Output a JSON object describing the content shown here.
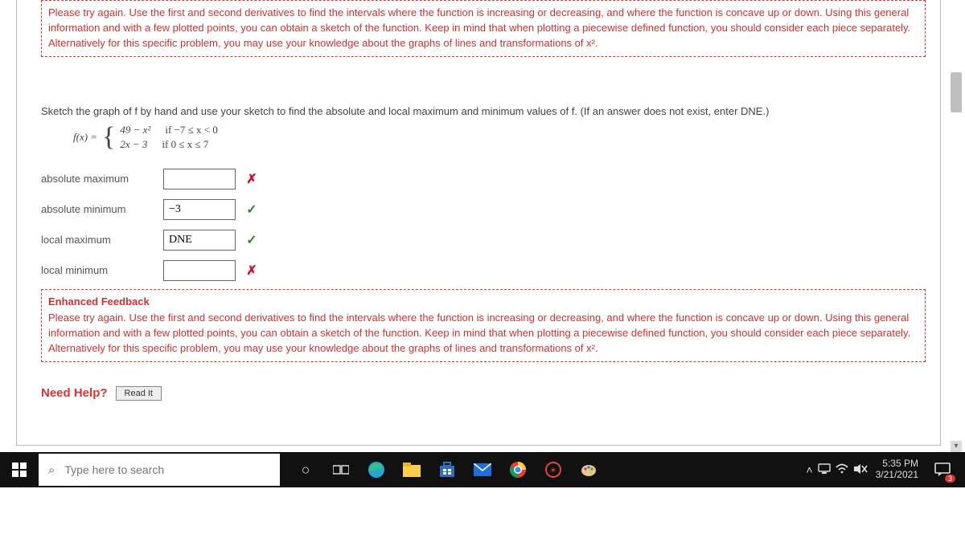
{
  "feedback_top": {
    "text": "Please try again. Use the first and second derivatives to find the intervals where the function is increasing or decreasing, and where the function is concave up or down. Using this general information and with a few plotted points, you can obtain a sketch of the function. Keep in mind that when plotting a piecewise defined function, you should consider each piece separately. Alternatively for this specific problem, you may use your knowledge about the graphs of lines and transformations of  x²."
  },
  "prompt": "Sketch the graph of f by hand and use your sketch to find the absolute and local maximum and minimum values of f. (If an answer does not exist, enter DNE.)",
  "func": {
    "lhs": "f(x) = ",
    "piece1_expr": "49 − x²",
    "piece1_cond": "if −7 ≤ x < 0",
    "piece2_expr": "2x − 3",
    "piece2_cond": "if 0 ≤ x ≤ 7"
  },
  "answers": {
    "absmax_label": "absolute maximum",
    "absmax_value": "",
    "absmax_mark": "✗",
    "absmin_label": "absolute minimum",
    "absmin_value": "−3",
    "absmin_mark": "✓",
    "locmax_label": "local maximum",
    "locmax_value": "DNE",
    "locmax_mark": "✓",
    "locmin_label": "local minimum",
    "locmin_value": "",
    "locmin_mark": "✗"
  },
  "feedback_bottom": {
    "title": "Enhanced Feedback",
    "text": "Please try again. Use the first and second derivatives to find the intervals where the function is increasing or decreasing, and where the function is concave up or down. Using this general information and with a few plotted points, you can obtain a sketch of the function. Keep in mind that when plotting a piecewise defined function, you should consider each piece separately. Alternatively for this specific problem, you may use your knowledge about the graphs of lines and transformations of  x²."
  },
  "need_help": {
    "label": "Need Help?",
    "button": "Read It"
  },
  "taskbar": {
    "search_placeholder": "Type here to search",
    "time": "5:35 PM",
    "date": "3/21/2021",
    "notif_count": "3"
  }
}
